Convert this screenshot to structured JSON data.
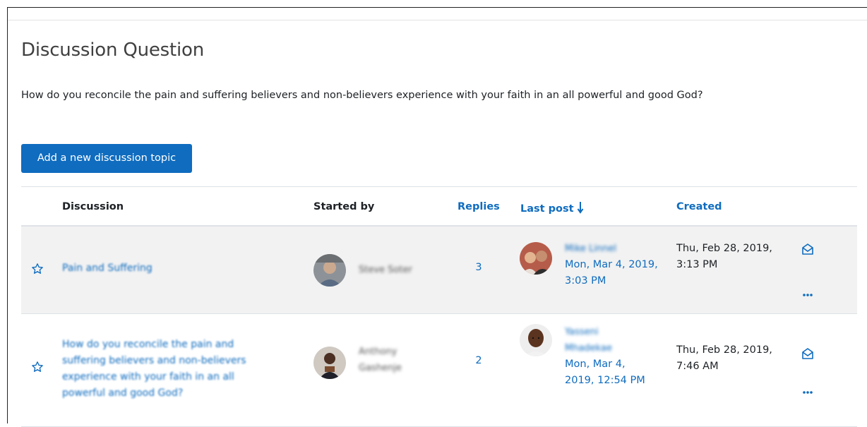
{
  "page": {
    "title": "Discussion Question",
    "question": "How do you reconcile the pain and suffering believers and non-believers experience with your faith in an all powerful and good God?",
    "add_button_label": "Add a new discussion topic"
  },
  "table": {
    "columns": {
      "discussion": "Discussion",
      "started_by": "Started by",
      "replies": "Replies",
      "last_post": "Last post",
      "created": "Created"
    },
    "rows": [
      {
        "topic": "Pain and Suffering",
        "author": "Steve Soter",
        "replies": "3",
        "last_post_author": "Mike Linnel",
        "last_post_date": "Mon, Mar 4, 2019, 3:03 PM",
        "created": "Thu, Feb 28, 2019, 3:13 PM"
      },
      {
        "topic": "How do you reconcile the pain and suffering believers and non-believers experience with your faith in an all powerful and good God?",
        "author": "Anthony Gashenje",
        "replies": "2",
        "last_post_author": "Yasseni Mhadekae",
        "last_post_date": "Mon, Mar 4, 2019, 12:54 PM",
        "created": "Thu, Feb 28, 2019, 7:46 AM"
      }
    ]
  },
  "colors": {
    "accent": "#0f6cbf",
    "row_highlight": "#f2f2f2",
    "text": "#1d2125"
  },
  "icons": [
    "star-outline-icon",
    "subscribe-envelope-icon",
    "more-actions-icon",
    "sort-down-arrow-icon"
  ]
}
